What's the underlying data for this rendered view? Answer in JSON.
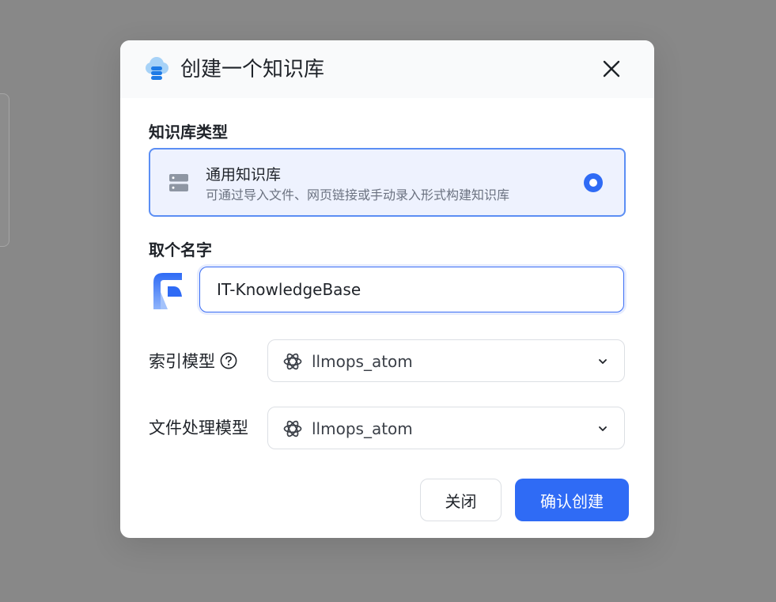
{
  "dialog": {
    "title": "创建一个知识库",
    "header_icon": "database-cloud-icon",
    "close_icon": "close-icon"
  },
  "kb_type": {
    "section_label": "知识库类型",
    "options": [
      {
        "title": "通用知识库",
        "description": "可通过导入文件、网页链接或手动录入形式构建知识库",
        "icon": "server-icon",
        "selected": true
      }
    ]
  },
  "name": {
    "section_label": "取个名字",
    "value": "IT-KnowledgeBase",
    "icon": "knowledge-base-logo-icon"
  },
  "index_model": {
    "label": "索引模型",
    "help_icon": "question-circle-icon",
    "value": "llmops_atom",
    "icon": "openai-icon"
  },
  "file_model": {
    "label": "文件处理模型",
    "value": "llmops_atom",
    "icon": "openai-icon"
  },
  "footer": {
    "cancel_label": "关闭",
    "confirm_label": "确认创建"
  },
  "colors": {
    "primary": "#2f6bf5",
    "overlay": "#888888",
    "selected_card_bg": "#eef2fe"
  }
}
